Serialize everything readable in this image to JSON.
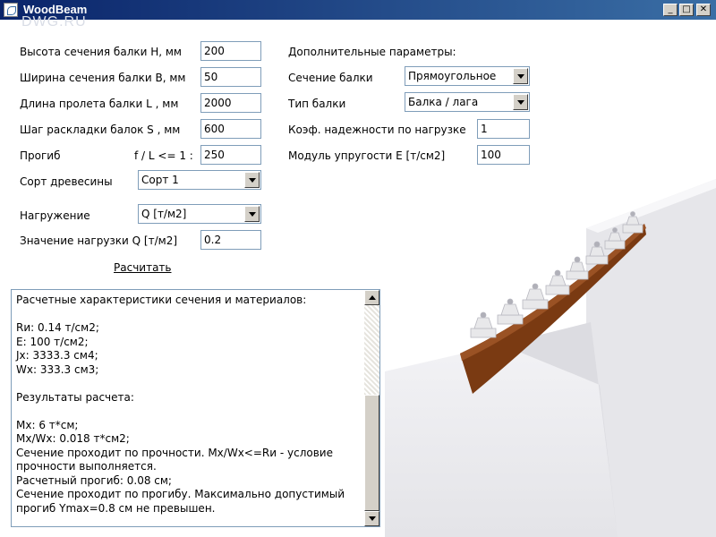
{
  "window": {
    "title": "WoodBeam",
    "watermark": "DWG.RU",
    "controls": {
      "minimize": "_",
      "maximize": "□",
      "close": "✕"
    }
  },
  "fields": {
    "height": {
      "label": "Высота сечения балки H, мм",
      "value": "200"
    },
    "width": {
      "label": "Ширина сечения балки B, мм",
      "value": "50"
    },
    "span": {
      "label": "Длина пролета балки L  , мм",
      "value": "2000"
    },
    "spacing": {
      "label": "Шаг раскладки балок S  , мм",
      "value": "600"
    },
    "deflection": {
      "label": "Прогиб",
      "ratio_label": "f / L <= 1 :",
      "value": "250"
    },
    "wood_grade": {
      "label": "Сорт древесины",
      "value": "Сорт 1"
    },
    "load_type": {
      "label": "Нагружение",
      "value": "Q [т/м2]"
    },
    "load_value": {
      "label": "Значение нагрузки Q [т/м2]",
      "value": "0.2"
    }
  },
  "extra": {
    "heading": "Дополнительные параметры:",
    "section": {
      "label": "Сечение балки",
      "value": "Прямоугольное"
    },
    "beam_type": {
      "label": "Тип балки",
      "value": "Балка / лага"
    },
    "reliability": {
      "label": "Коэф. надежности по нагрузке",
      "value": "1"
    },
    "modulus": {
      "label": "Модуль упругости  E  [т/см2]",
      "value": "100"
    }
  },
  "calculate_label": "Расчитать",
  "results": {
    "lines": [
      "Расчетные характеристики сечения и материалов:",
      "",
      "Rи: 0.14 т/см2;",
      "E: 100 т/см2;",
      "Jx: 3333.3 см4;",
      "Wx: 333.3 см3;",
      "",
      "Результаты расчета:",
      "",
      "Mx: 6 т*см;",
      "Mx/Wx: 0.018 т*см2;",
      "Сечение проходит по прочности. Mx/Wx<=Rи - условие прочности выполняется.",
      "Расчетный прогиб: 0.08 см;",
      "Сечение проходит по прогибу. Максимально допустимый прогиб Ymax=0.8 см не превышен."
    ]
  },
  "colors": {
    "titlebar_start": "#0a246a",
    "titlebar_end": "#3a6ea5",
    "beam": "#7a3a12",
    "support": "#e8e8ea"
  }
}
